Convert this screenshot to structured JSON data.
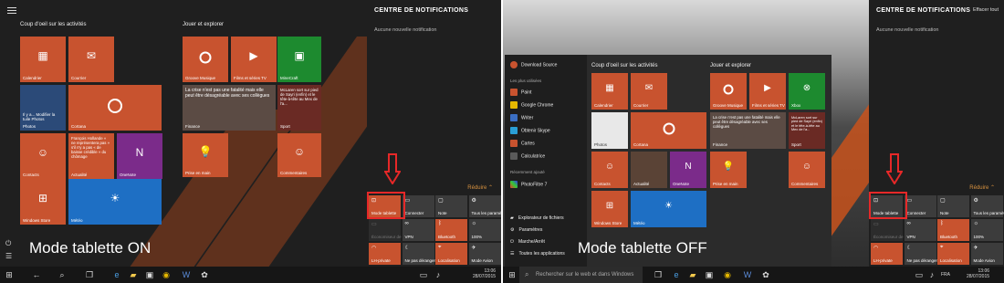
{
  "left": {
    "caption": "Mode tablette ON",
    "section_activities": "Coup d'oeil sur les activités",
    "section_games": "Jouer et explorer",
    "tiles": {
      "calendrier": "Calendrier",
      "courrier": "Courrier",
      "cortana": "Cortana",
      "groove": "Groove Musique",
      "films": "Films et séries TV",
      "minecraft_title": "MineCraft",
      "news": "La crise n'est pas une fatalité mais elle peut être désagréable avec ses collègues",
      "finance": "Finance",
      "sport_news": "McLaren sort sur pied de Sayri (enfin) et le tête-à-tête au Mex de l'a...",
      "sport": "Sport",
      "photos_text": "Il y a... Modifier la tuile Photos",
      "photos": "Photos",
      "actualite_text": "François Hollande « ne représentera pas » s'il n'y a pas « de baisse crédible » du chômage",
      "contacts": "Contacts",
      "actualite": "Actualité",
      "onenote": "OneNote",
      "prise_en_main": "Prise en main",
      "commentaires": "Commentaires",
      "store": "Windows Store",
      "meteo": "Météo"
    },
    "action_center": {
      "title": "CENTRE DE NOTIFICATIONS",
      "subtitle": "Aucune nouvelle notification",
      "reduire": "Réduire ⌃",
      "quick_actions": [
        {
          "label": "Mode tablette",
          "icon": "⊡",
          "state": "on"
        },
        {
          "label": "Connecter",
          "icon": "▭",
          "state": "off"
        },
        {
          "label": "Note",
          "icon": "▢",
          "state": "off"
        },
        {
          "label": "Tous les paramètres",
          "icon": "⚙",
          "state": "off"
        },
        {
          "label": "Économiseur de batterie",
          "icon": "▭",
          "state": "dim"
        },
        {
          "label": "VPN",
          "icon": "∞",
          "state": "off"
        },
        {
          "label": "Bluetooth",
          "icon": "ᛒ",
          "state": "on"
        },
        {
          "label": "100%",
          "icon": "☼",
          "state": "off"
        },
        {
          "label": "LH-private",
          "icon": "◠",
          "state": "on"
        },
        {
          "label": "Ne pas déranger",
          "icon": "☾",
          "state": "off"
        },
        {
          "label": "Localisation",
          "icon": "⌖",
          "state": "on"
        },
        {
          "label": "Mode Avion",
          "icon": "✈",
          "state": "off"
        }
      ]
    },
    "taskbar": {
      "time": "13:06",
      "date": "28/07/2015"
    }
  },
  "right": {
    "caption": "Mode tablette OFF",
    "search_placeholder": "Rechercher sur le web et dans Windows",
    "section_activities": "Coup d'oeil sur les activités",
    "section_games": "Jouer et explorer",
    "start_left": {
      "user": "Download Source",
      "most_used": "Les plus utilisées",
      "apps": [
        "Paint",
        "Google Chrome",
        "Writer",
        "Obtenir Skype",
        "Cartes",
        "Calculatrice"
      ],
      "recent": "Récemment ajouté",
      "recent_app": "PhotoFiltre 7",
      "bottom": [
        "Explorateur de fichiers",
        "Paramètres",
        "Marche/Arrêt",
        "Toutes les applications"
      ]
    },
    "tiles": {
      "calendrier": "Calendrier",
      "courrier": "Courrier",
      "cortana": "Cortana",
      "groove": "Groove Musique",
      "films": "Films et séries TV",
      "xbox": "Xbox",
      "news": "La crise n'est pas une fatalité mais elle peut être désagréable avec ses collègues",
      "finance": "Finance",
      "sport_news": "McLaren sort sur pied de Sayri (enfin) et le tête-à-tête au Mex de l'a...",
      "sport": "Sport",
      "photos": "Photos",
      "contacts": "Contacts",
      "actualite": "Actualité",
      "onenote": "OneNote",
      "prise_en_main": "Prise en main",
      "commentaires": "Commentaires",
      "store": "Windows Store",
      "meteo": "Météo"
    },
    "action_center": {
      "title": "CENTRE DE NOTIFICATIONS",
      "subtitle": "Aucune nouvelle notification",
      "effacer": "Effacer tout",
      "reduire": "Réduire ⌃",
      "quick_actions": [
        {
          "label": "Mode tablette",
          "icon": "⊡",
          "state": "off"
        },
        {
          "label": "Connecter",
          "icon": "▭",
          "state": "off"
        },
        {
          "label": "Note",
          "icon": "▢",
          "state": "off"
        },
        {
          "label": "Tous les paramètres",
          "icon": "⚙",
          "state": "off"
        },
        {
          "label": "Économiseur de batterie",
          "icon": "▭",
          "state": "dim"
        },
        {
          "label": "VPN",
          "icon": "∞",
          "state": "off"
        },
        {
          "label": "Bluetooth",
          "icon": "ᛒ",
          "state": "on"
        },
        {
          "label": "100%",
          "icon": "☼",
          "state": "off"
        },
        {
          "label": "LH-private",
          "icon": "◠",
          "state": "on"
        },
        {
          "label": "Ne pas déranger",
          "icon": "☾",
          "state": "off"
        },
        {
          "label": "Localisation",
          "icon": "⌖",
          "state": "on"
        },
        {
          "label": "Mode Avion",
          "icon": "✈",
          "state": "off"
        }
      ]
    },
    "taskbar": {
      "lang": "FRA",
      "time": "13:06",
      "date": "28/07/2015"
    }
  },
  "colors": {
    "accent": "#c8532f",
    "blue": "#1e6fc4",
    "green": "#1d8a2f",
    "purple": "#7b2b8a",
    "red_marker": "#e62828",
    "reduire": "#d7913f"
  }
}
